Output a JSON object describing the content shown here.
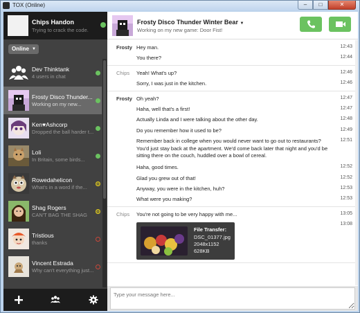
{
  "window": {
    "title": "TOX (Online)"
  },
  "self": {
    "name": "Chips Handon",
    "status_message": "Trying to crack the code.",
    "status": "Online"
  },
  "contacts": [
    {
      "name": "Dev Thinktank",
      "message": "4 users in chat",
      "status": "online",
      "avatar": "group-icon"
    },
    {
      "name": "Frosty Disco Thunder...",
      "message": "Working on my new...",
      "status": "online",
      "avatar": "frosty"
    },
    {
      "name": "Ken♥Ashcorp",
      "message": "Dropped the ball harder t...",
      "status": "online",
      "avatar": "ken"
    },
    {
      "name": "Loli",
      "message": "In Britain, some birds...",
      "status": "online",
      "avatar": "loli"
    },
    {
      "name": "Rowedahelicon",
      "message": "What's in a word if the...",
      "status": "away",
      "avatar": "rowe"
    },
    {
      "name": "Shag Rogers",
      "message": "CAN'T BAG THE SHAG",
      "status": "away",
      "avatar": "shag"
    },
    {
      "name": "Tristious",
      "message": "thanks",
      "status": "offline",
      "avatar": "tristious"
    },
    {
      "name": "Vincent Estrada",
      "message": "Why can't everything just...",
      "status": "offline",
      "avatar": "vincent"
    }
  ],
  "chat": {
    "name": "Frosty Disco Thunder Winter Bear",
    "status_message": "Working on my new game: Door Fist!",
    "groups": [
      {
        "author": "Frosty",
        "self": true,
        "messages": [
          {
            "text": "Hey man.",
            "time": "12:43"
          },
          {
            "text": "You there?",
            "time": "12:44"
          }
        ]
      },
      {
        "author": "Chips",
        "self": false,
        "messages": [
          {
            "text": "Yeah! What's up?",
            "time": "12:46"
          },
          {
            "text": "Sorry, I was just in the kitchen.",
            "time": "12:46"
          }
        ]
      },
      {
        "author": "Frosty",
        "self": true,
        "messages": [
          {
            "text": "Oh yeah?",
            "time": "12:47"
          },
          {
            "text": "Haha, well that's a first!",
            "time": "12:47"
          },
          {
            "text": "Actually Linda and I were talking about the other day.",
            "time": "12:48"
          },
          {
            "text": "Do you remember how it used to be?",
            "time": "12:49"
          },
          {
            "text": "Remember back in college when you would never want to go out to restaurants? You'd just stay back at the apartment. We'd come back later that night and you'd be sitting there on the couch, huddled over a bowl of cereal.",
            "time": "12:51"
          },
          {
            "text": "Haha, good times.",
            "time": "12:52"
          },
          {
            "text": "Glad you grew out of that!",
            "time": "12:52"
          },
          {
            "text": "Anyway, you were in the kitchen, huh?",
            "time": "12:53"
          },
          {
            "text": "What were you making?",
            "time": "12:53"
          }
        ]
      },
      {
        "author": "Chips",
        "self": false,
        "messages": [
          {
            "text": "You're not going to be very happy with me...",
            "time": "13:05"
          },
          {
            "text": "",
            "time": "13:08"
          }
        ]
      }
    ],
    "file_transfer": {
      "title": "File Transfer:",
      "filename": "DSC_01377.jpg",
      "dimensions": "2048x1152",
      "size": "628KB"
    },
    "input_placeholder": "Type your message here..."
  },
  "colors": {
    "online": "#6bc260",
    "away": "#d4c020",
    "offline": "#c9483a",
    "sidebar": "#414141",
    "sidebar_dark": "#1c1c1c"
  }
}
